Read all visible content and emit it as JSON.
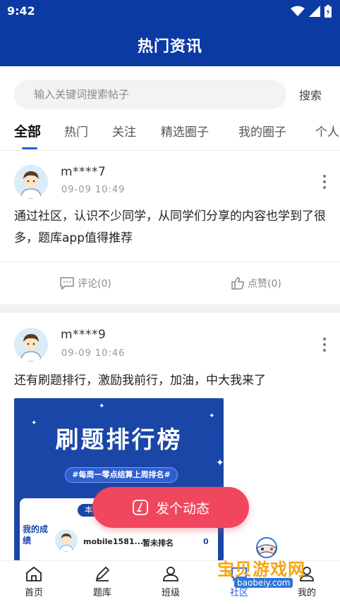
{
  "status_bar": {
    "time": "9:42"
  },
  "header": {
    "title": "热门资讯"
  },
  "search": {
    "placeholder": "输入关键词搜索帖子",
    "button_label": "搜索"
  },
  "tabs": [
    {
      "label": "全部",
      "active": true
    },
    {
      "label": "热门"
    },
    {
      "label": "关注"
    },
    {
      "label": "精选圈子"
    },
    {
      "label": "我的圈子"
    },
    {
      "label": "个人"
    }
  ],
  "posts": [
    {
      "username": "m****7",
      "time": "09-09 10:49",
      "content": "通过社区，认识不少同学，从同学们分享的内容也学到了很多，题库app值得推荐",
      "comment_label": "评论(0)",
      "like_label": "点赞(0)"
    },
    {
      "username": "m****9",
      "time": "09-09 10:46",
      "content": "还有刷题排行，激励我前行，加油，中大我来了",
      "image": {
        "title": "刷题排行榜",
        "subtitle": "#每周一零点结算上周排名#",
        "card_tab": "本",
        "my_score_label": "我的成绩",
        "user": "mobile1581...",
        "rank": "暂未排名",
        "score": "0"
      }
    }
  ],
  "fab": {
    "label": "发个动态"
  },
  "bottom_nav": [
    {
      "label": "首页",
      "icon": "home-icon"
    },
    {
      "label": "题库",
      "icon": "pencil-icon"
    },
    {
      "label": "班级",
      "icon": "class-icon"
    },
    {
      "label": "社区",
      "icon": "community-icon"
    },
    {
      "label": "我的",
      "icon": "profile-icon"
    }
  ],
  "watermark": {
    "text": "宝贝游戏网",
    "url": "baobeiy.com"
  },
  "colors": {
    "header": "#0b3aa3",
    "accent": "#2a5bd7",
    "fab": "#f0475e"
  }
}
